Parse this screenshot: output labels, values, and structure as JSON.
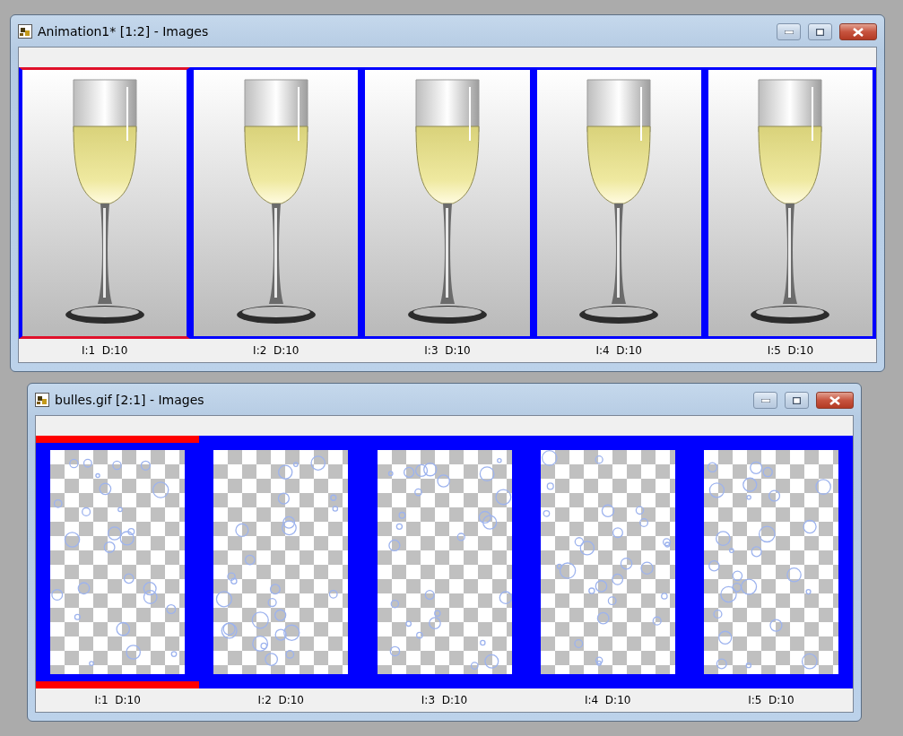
{
  "windows": [
    {
      "title": "Animation1* [1:2] - Images",
      "kind": "glass",
      "frames": [
        {
          "label": "I:1  D:10",
          "selected": true
        },
        {
          "label": "I:2  D:10",
          "selected": false
        },
        {
          "label": "I:3  D:10",
          "selected": false
        },
        {
          "label": "I:4  D:10",
          "selected": false
        },
        {
          "label": "I:5  D:10",
          "selected": false
        }
      ]
    },
    {
      "title": "bulles.gif [2:1] - Images",
      "kind": "bubbles",
      "frames": [
        {
          "label": "I:1  D:10",
          "selected": true
        },
        {
          "label": "I:2  D:10",
          "selected": false
        },
        {
          "label": "I:3  D:10",
          "selected": false
        },
        {
          "label": "I:4  D:10",
          "selected": false
        },
        {
          "label": "I:5  D:10",
          "selected": false
        }
      ]
    }
  ]
}
